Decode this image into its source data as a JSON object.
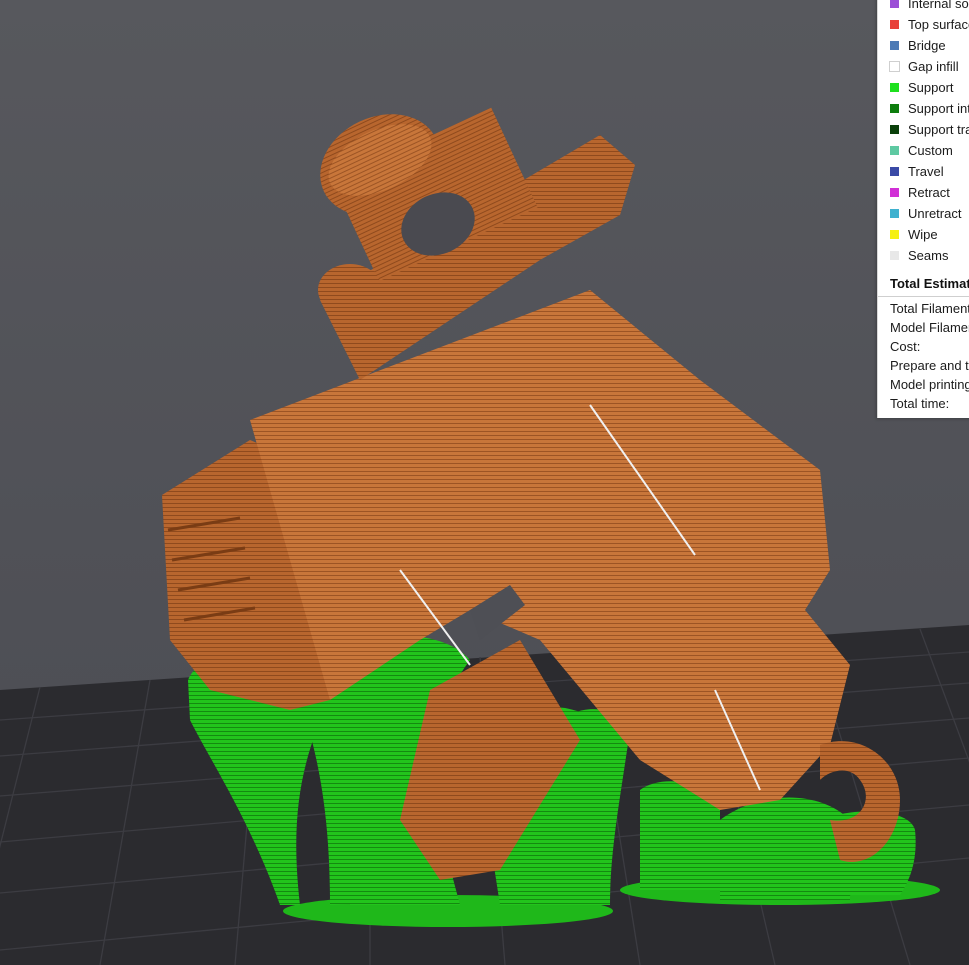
{
  "app": {
    "view": "gcode-preview"
  },
  "legend": {
    "items": [
      {
        "label": "Internal solid infill",
        "color": "#9b4fd6"
      },
      {
        "label": "Top surface",
        "color": "#e8413a"
      },
      {
        "label": "Bridge",
        "color": "#4d7ab5"
      },
      {
        "label": "Gap infill",
        "color": "#ffffff"
      },
      {
        "label": "Support",
        "color": "#1ee01e"
      },
      {
        "label": "Support interface",
        "color": "#0d7d0d"
      },
      {
        "label": "Support transition",
        "color": "#0a3f0a"
      },
      {
        "label": "Custom",
        "color": "#5ec9a2"
      },
      {
        "label": "Travel",
        "color": "#3a4aa6"
      },
      {
        "label": "Retract",
        "color": "#d12fd6"
      },
      {
        "label": "Unretract",
        "color": "#3fb1cf"
      },
      {
        "label": "Wipe",
        "color": "#f5f010"
      },
      {
        "label": "Seams",
        "color": "#e8e8e8"
      }
    ],
    "estimation": {
      "header": "Total Estimation",
      "lines": [
        "Total Filament:",
        "Model Filament:",
        "Cost:",
        "Prepare and time:",
        "Model printing time:",
        "Total time:"
      ]
    }
  },
  "colors": {
    "model": "#b8662e",
    "support": "#22c41c",
    "bed": "#2b2b2f",
    "background": "#55565b"
  }
}
